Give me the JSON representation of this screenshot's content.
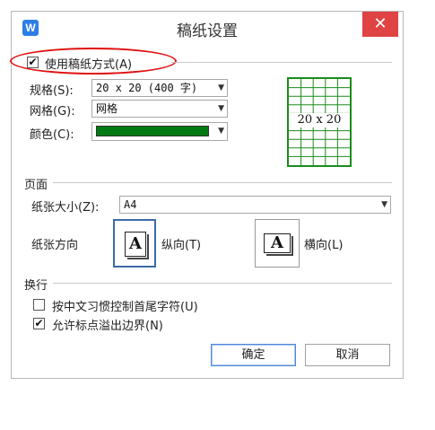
{
  "window": {
    "title": "稿纸设置",
    "app_icon_letter": "W",
    "close_glyph": "✕"
  },
  "use_manuscript": {
    "label": "使用稿纸方式(A)",
    "checked": true
  },
  "spec": {
    "label": "规格(S):",
    "value": "20 x 20 (400 字)"
  },
  "grid": {
    "label": "网格(G):",
    "value": "网格"
  },
  "color": {
    "label": "颜色(C):",
    "value_hex": "#007a12"
  },
  "preview": {
    "text": "20 x 20",
    "rows": 10,
    "cols": 5,
    "line_color": "#1a8c1a"
  },
  "page": {
    "section_label": "页面",
    "paper_size_label": "纸张大小(Z):",
    "paper_size_value": "A4",
    "orientation_label": "纸张方向",
    "portrait_label": "纵向(T)",
    "landscape_label": "横向(L)",
    "icon_letter": "A",
    "selected_orientation": "portrait"
  },
  "wrap": {
    "section_label": "换行",
    "option1": {
      "label": "按中文习惯控制首尾字符(U)",
      "checked": false
    },
    "option2": {
      "label": "允许标点溢出边界(N)",
      "checked": true
    }
  },
  "buttons": {
    "ok": "确定",
    "cancel": "取消"
  },
  "icons": {
    "check": "✔",
    "dropdown": "▼"
  }
}
